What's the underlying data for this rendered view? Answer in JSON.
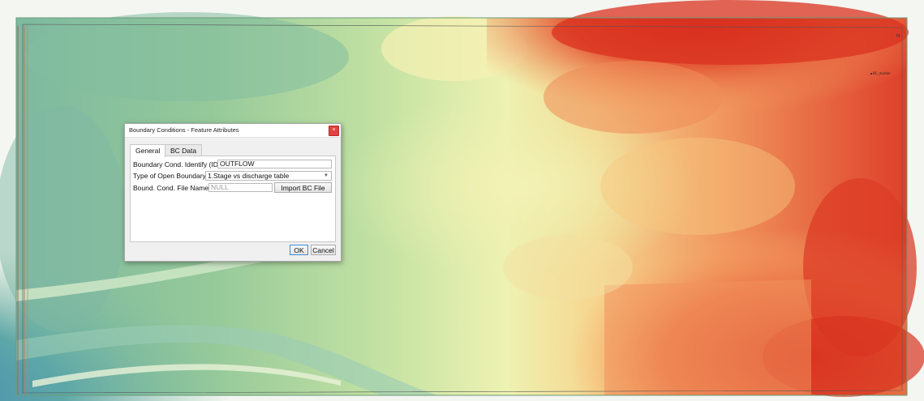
{
  "map": {
    "label": "BC_marker",
    "north": "N"
  },
  "dialog": {
    "title": "Boundary Conditions - Feature Attributes",
    "close_glyph": "×",
    "tabs": [
      {
        "label": "General",
        "active": true
      },
      {
        "label": "BC Data",
        "active": false
      }
    ],
    "fields": {
      "id_label": "Boundary Cond. Identify (ID)",
      "id_value": "OUTFLOW",
      "type_label": "Type of Open Boundary",
      "type_value": "1.Stage vs discharge table",
      "file_label": "Bound. Cond. File Name",
      "file_placeholder": "NULL",
      "import_label": "Import BC File"
    },
    "ok_label": "OK",
    "cancel_label": "Cancel"
  },
  "icons": {
    "close": "close-icon",
    "dropdown": "chevron-down-icon"
  },
  "colors": {
    "terrain_low": "#3d87b3",
    "terrain_mid": "#f2f2b0",
    "terrain_high": "#d7271f",
    "close_button": "#e0443e"
  }
}
